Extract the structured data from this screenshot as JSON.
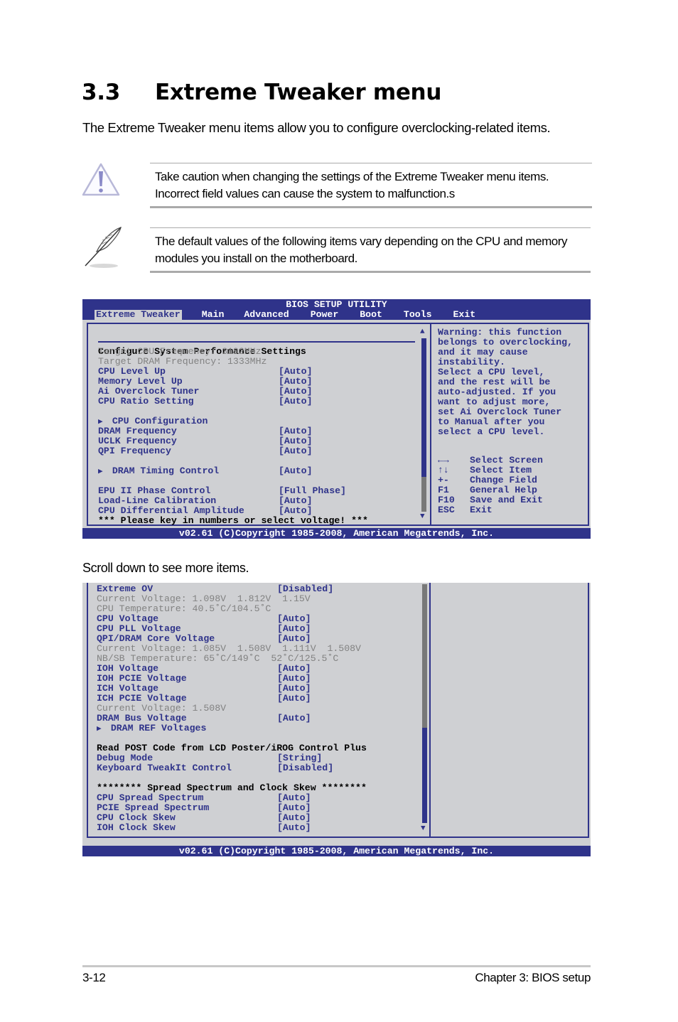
{
  "page": {
    "section_number": "3.3",
    "section_title": "Extreme Tweaker menu",
    "intro": "The Extreme Tweaker menu items allow you to configure overclocking-related items.",
    "caution_note": "Take caution when changing the settings of the Extreme Tweaker menu items. Incorrect field values can cause the system to malfunction.s",
    "info_note": "The default values of the following items vary depending on the CPU and memory modules you install on the motherboard.",
    "scroll_label": "Scroll down to see more items.",
    "footer_page": "3-12",
    "footer_chapter": "Chapter 3: BIOS setup"
  },
  "icons": {
    "caution": "warning-triangle-icon",
    "note": "quill-pen-icon",
    "submenu": "triangle-right-icon",
    "scroll_up": "scroll-up-arrow-icon",
    "scroll_down": "scroll-down-arrow-icon"
  },
  "colors": {
    "bios_blue": "#2f338a",
    "bios_bg": "#cfd0d3",
    "bios_grey_text": "#828282",
    "scroll_thumb_grey": "#787878"
  },
  "bios": {
    "utility_title": "BIOS SETUP UTILITY",
    "menu": [
      "Extreme Tweaker",
      "Main",
      "Advanced",
      "Power",
      "Boot",
      "Tools",
      "Exit"
    ],
    "active_menu": "Extreme Tweaker",
    "copyright": "v02.61 (C)Copyright 1985-2008, American Megatrends, Inc.",
    "screen1": {
      "heading": "Configure System Performance Settings",
      "scroll_position": 0.8,
      "lines": [
        {
          "type": "info",
          "text": "Target CPU Frequency: 3192MHz"
        },
        {
          "type": "info",
          "text": "Target DRAM Frequency: 1333MHz"
        },
        {
          "type": "item",
          "label": "CPU Level Up",
          "value": "[Auto]"
        },
        {
          "type": "item",
          "label": "Memory Level Up",
          "value": "[Auto]"
        },
        {
          "type": "item",
          "label": "Ai Overclock Tuner",
          "value": "[Auto]"
        },
        {
          "type": "item",
          "label": "CPU Ratio Setting",
          "value": "[Auto]"
        },
        {
          "type": "blank"
        },
        {
          "type": "submenu",
          "label": "CPU Configuration",
          "value": ""
        },
        {
          "type": "item",
          "label": "DRAM Frequency",
          "value": "[Auto]"
        },
        {
          "type": "item",
          "label": "UCLK Frequency",
          "value": "[Auto]"
        },
        {
          "type": "item",
          "label": "QPI Frequency",
          "value": "[Auto]"
        },
        {
          "type": "blank"
        },
        {
          "type": "submenu",
          "label": "DRAM Timing Control",
          "value": "[Auto]"
        },
        {
          "type": "blank"
        },
        {
          "type": "item",
          "label": "EPU II Phase Control",
          "value": "[Full Phase]"
        },
        {
          "type": "item",
          "label": "Load-Line Calibration",
          "value": "[Auto]"
        },
        {
          "type": "item",
          "label": "CPU Differential Amplitude",
          "value": "[Auto]"
        },
        {
          "type": "header",
          "text": "*** Please key in numbers or select voltage! ***"
        }
      ],
      "help_text": [
        "Warning: this function",
        "belongs to overclocking,",
        "and it may cause",
        "instability.",
        "Select a CPU level,",
        "and the rest will be",
        "auto-adjusted. If you",
        "want to adjust more,",
        "set Ai Overclock Tuner",
        "to Manual after you",
        "select a CPU level."
      ],
      "keys": [
        {
          "key": "←→",
          "action": "Select Screen"
        },
        {
          "key": "↑↓",
          "action": "Select Item"
        },
        {
          "key": "+-",
          "action": "Change Field"
        },
        {
          "key": "F1",
          "action": "General Help"
        },
        {
          "key": "F10",
          "action": "Save and Exit"
        },
        {
          "key": "ESC",
          "action": "Exit"
        }
      ]
    },
    "screen2": {
      "scroll_position": 0.4,
      "lines": [
        {
          "type": "item",
          "label": "Extreme OV",
          "value": "[Disabled]"
        },
        {
          "type": "info",
          "text": "Current Voltage: 1.098V  1.812V  1.15V"
        },
        {
          "type": "info",
          "text": "CPU Temperature: 40.5˚C/104.5˚C"
        },
        {
          "type": "item",
          "label": "CPU Voltage",
          "value": "[Auto]"
        },
        {
          "type": "item",
          "label": "CPU PLL Voltage",
          "value": "[Auto]"
        },
        {
          "type": "item",
          "label": "QPI/DRAM Core Voltage",
          "value": "[Auto]"
        },
        {
          "type": "info",
          "text": "Current Voltage: 1.085V  1.508V  1.111V  1.508V"
        },
        {
          "type": "info",
          "text": "NB/SB Temperature: 65˚C/149˚C  52˚C/125.5˚C"
        },
        {
          "type": "item",
          "label": "IOH Voltage",
          "value": "[Auto]"
        },
        {
          "type": "item",
          "label": "IOH PCIE Voltage",
          "value": "[Auto]"
        },
        {
          "type": "item",
          "label": "ICH Voltage",
          "value": "[Auto]"
        },
        {
          "type": "item",
          "label": "ICH PCIE Voltage",
          "value": "[Auto]"
        },
        {
          "type": "info",
          "text": "Current Voltage: 1.508V"
        },
        {
          "type": "item",
          "label": "DRAM Bus Voltage",
          "value": "[Auto]"
        },
        {
          "type": "submenu",
          "label": "DRAM REF Voltages",
          "value": ""
        },
        {
          "type": "blank"
        },
        {
          "type": "header",
          "text": "Read POST Code from LCD Poster/iROG Control Plus"
        },
        {
          "type": "item",
          "label": "Debug Mode",
          "value": "[String]"
        },
        {
          "type": "item",
          "label": "Keyboard TweakIt Control",
          "value": "[Disabled]"
        },
        {
          "type": "blank"
        },
        {
          "type": "header",
          "text": "******** Spread Spectrum and Clock Skew ********"
        },
        {
          "type": "item",
          "label": "CPU Spread Spectrum",
          "value": "[Auto]"
        },
        {
          "type": "item",
          "label": "PCIE Spread Spectrum",
          "value": "[Auto]"
        },
        {
          "type": "item",
          "label": "CPU Clock Skew",
          "value": "[Auto]"
        },
        {
          "type": "item",
          "label": "IOH Clock Skew",
          "value": "[Auto]"
        }
      ]
    }
  }
}
